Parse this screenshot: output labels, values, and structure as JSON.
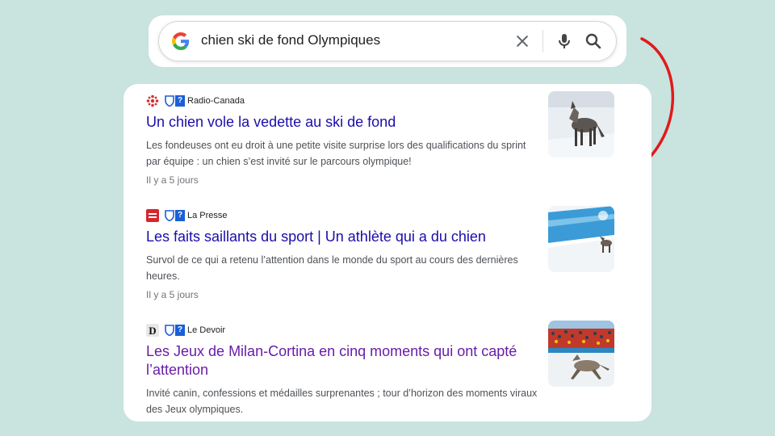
{
  "search": {
    "query": "chien ski de fond Olympiques"
  },
  "icons": {
    "logo": "google-g-icon",
    "clear": "close-icon",
    "voice": "microphone-icon",
    "search": "search-icon"
  },
  "colors": {
    "background": "#c9e3df",
    "link": "#1a0dab",
    "visited_link": "#681da8",
    "annotation_arrow": "#e01b1b"
  },
  "results": [
    {
      "source": "Radio-Canada",
      "title": "Un chien vole la vedette au ski de fond",
      "snippet": "Les fondeuses ont eu droit à une petite visite surprise lors des qualifications du sprint par équipe : un chien s’est invité sur le parcours olympique!",
      "date": "Il y a 5 jours"
    },
    {
      "source": "La Presse",
      "title": "Les faits saillants du sport | Un athlète qui a du chien",
      "snippet": "Survol de ce qui a retenu l’attention dans le monde du sport au cours des dernières heures.",
      "date": "Il y a 5 jours"
    },
    {
      "source": "Le Devoir",
      "title": "Les Jeux de Milan-Cortina en cinq moments qui ont capté l’attention",
      "snippet": "Invité canin, confessions et médailles surprenantes ; tour d’horizon des moments viraux des Jeux olympiques.",
      "date": ""
    }
  ]
}
